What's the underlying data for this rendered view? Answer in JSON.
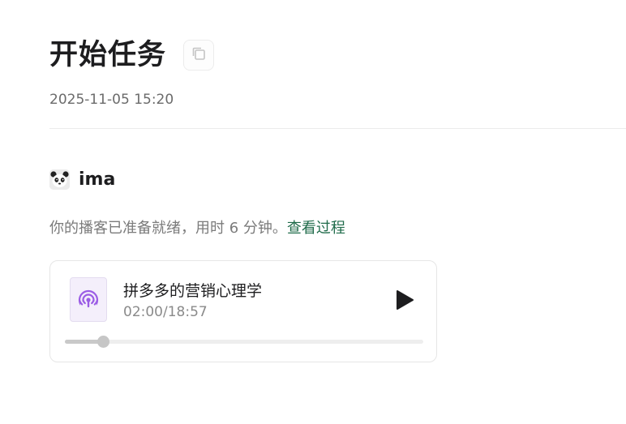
{
  "header": {
    "title": "开始任务",
    "copy_icon": "copy-icon",
    "timestamp": "2025-11-05 15:20"
  },
  "sender": {
    "avatar_icon": "panda-avatar-icon",
    "name": "ima"
  },
  "message": {
    "text": "你的播客已准备就绪，用时 6 分钟。",
    "link_text": "查看过程"
  },
  "player": {
    "icon": "podcast-icon",
    "title": "拼多多的营销心理学",
    "current_time": "02:00",
    "separator": "/",
    "duration": "18:57",
    "progress_fraction": 0.1055,
    "play_icon": "play-icon"
  },
  "colors": {
    "link": "#1f6b4a",
    "podcast_accent": "#9b5de5",
    "text_muted": "#7b7b7b"
  }
}
